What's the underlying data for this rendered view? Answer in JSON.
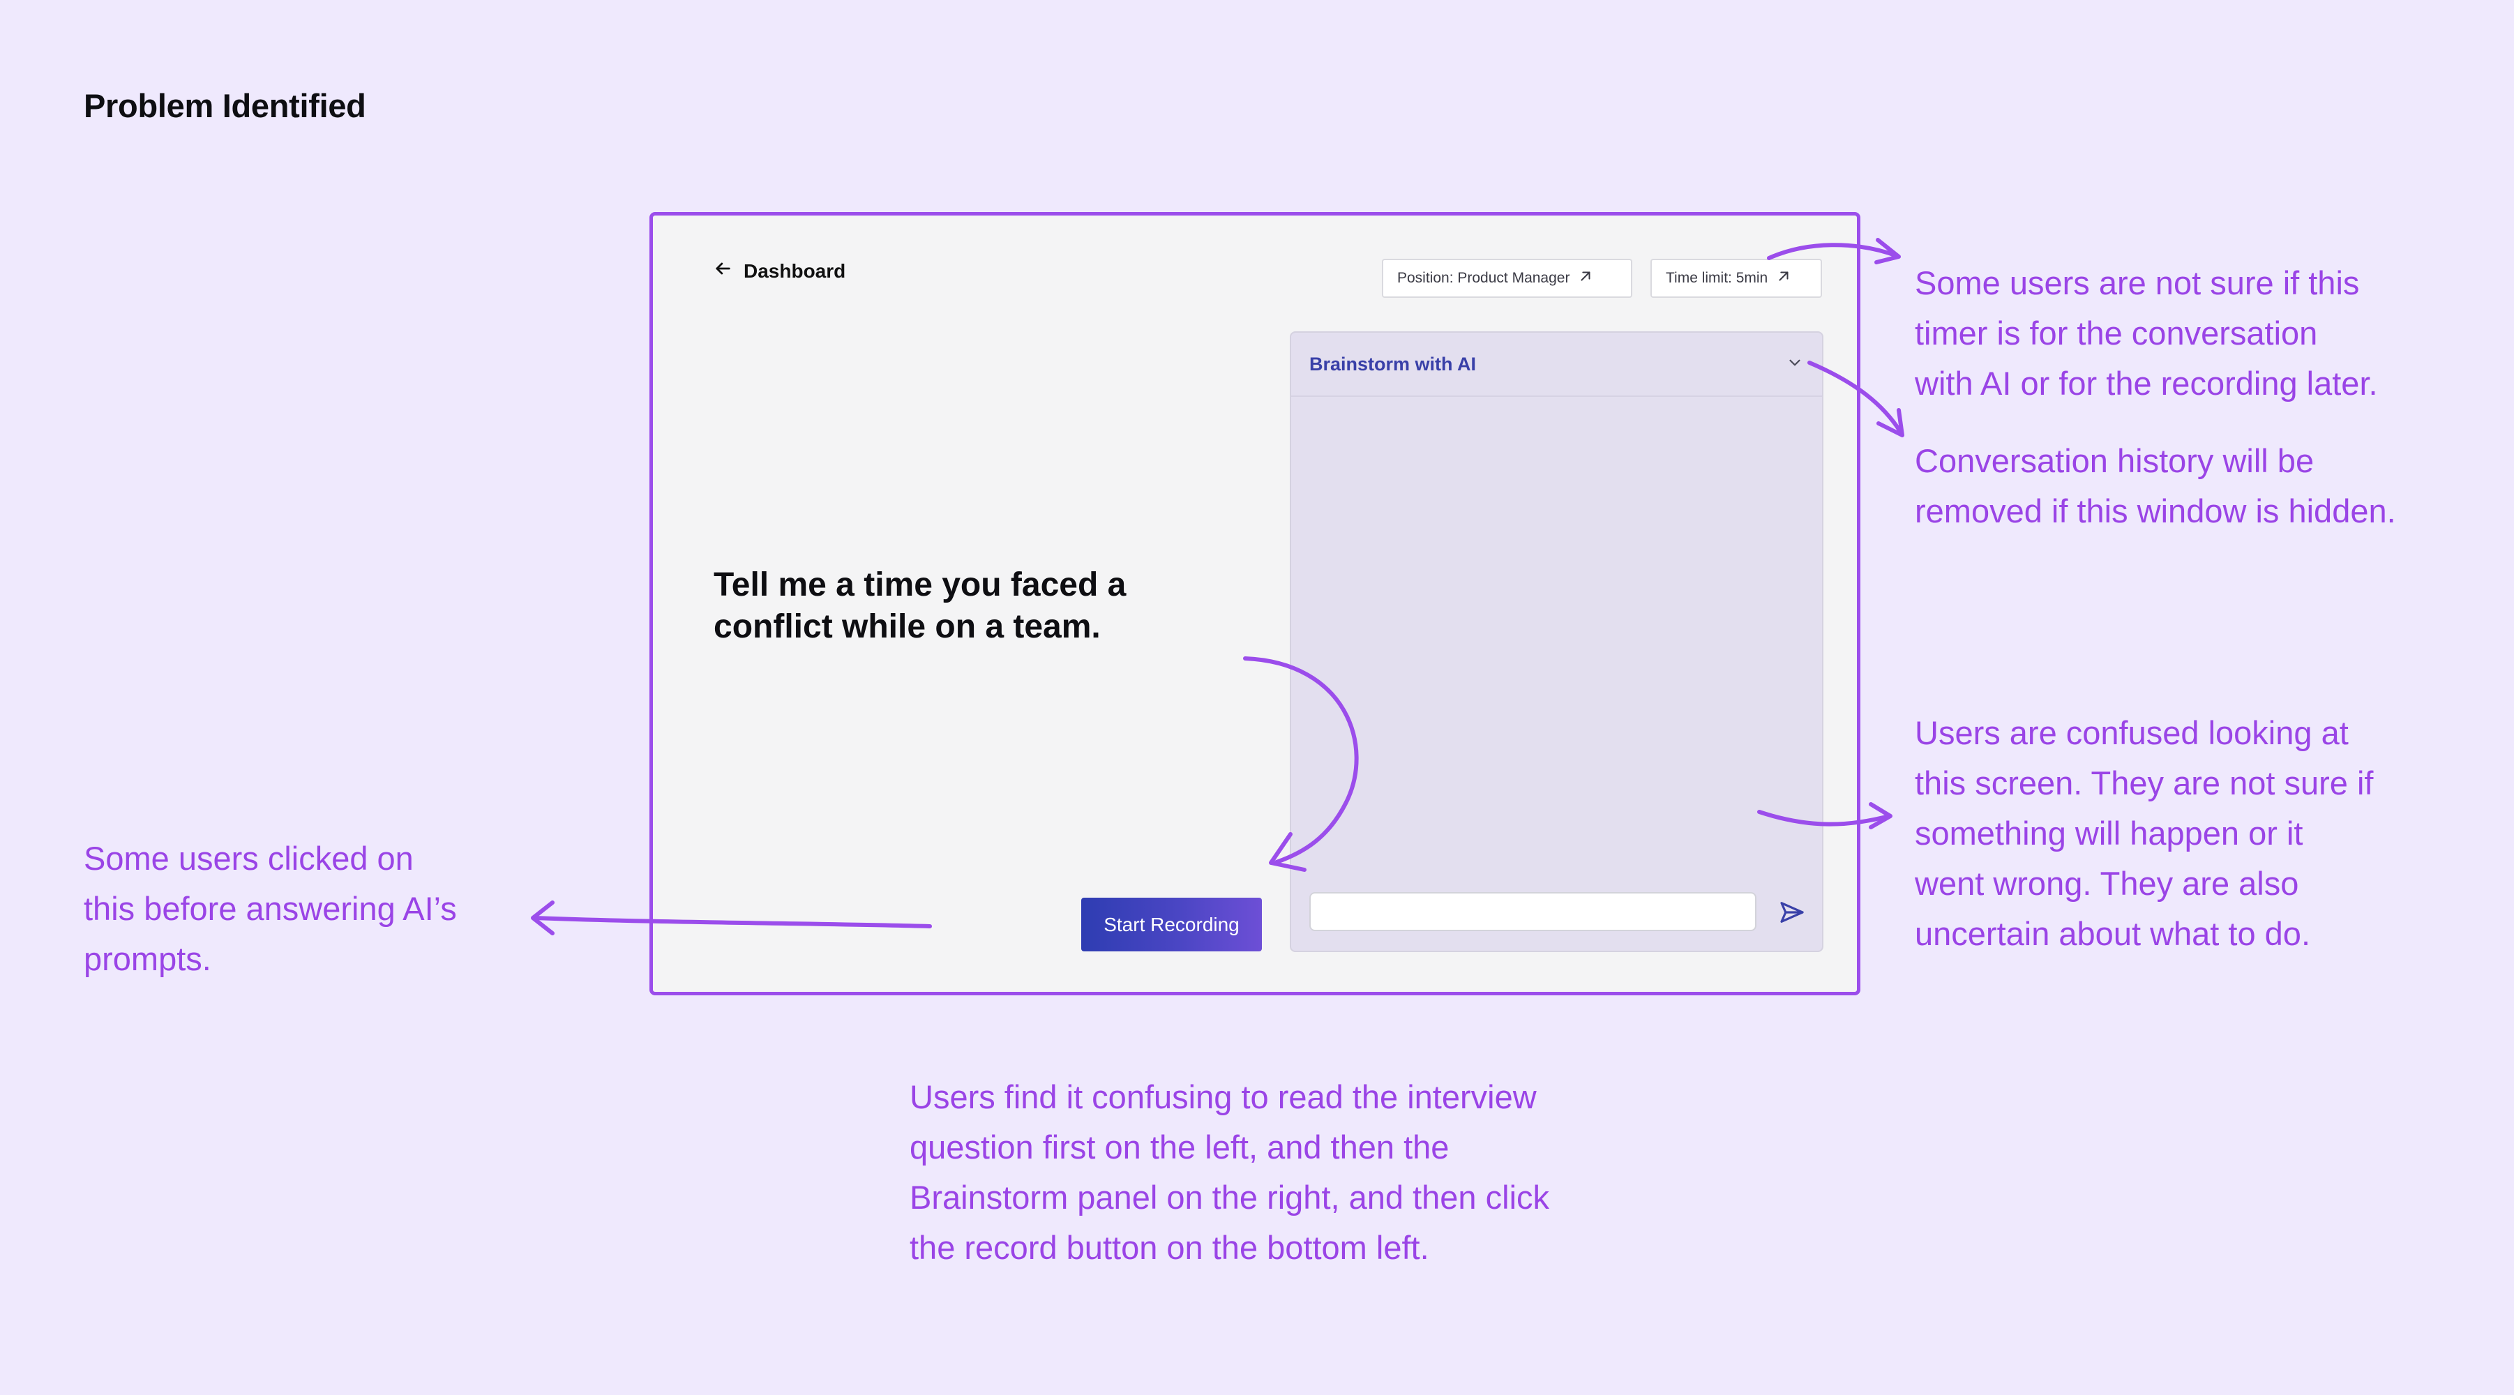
{
  "page": {
    "title": "Problem Identified"
  },
  "mockup": {
    "back_label": "Dashboard",
    "position_chip": "Position: Product Manager",
    "timer_chip": "Time limit: 5min",
    "question": "Tell me a time you faced a conflict while on a team.",
    "record_button": "Start Recording",
    "brainstorm": {
      "title": "Brainstorm with AI",
      "input_value": "",
      "input_placeholder": ""
    }
  },
  "annotations": {
    "timer": [
      "Some users are not sure if this",
      "timer is for the conversation",
      "with AI or for the recording later."
    ],
    "history": [
      "Conversation history will be",
      "removed if this window is hidden."
    ],
    "confused": [
      "Users are confused looking at",
      "this screen. They are not sure if",
      "something will happen or it",
      "went wrong. They are also",
      "uncertain about what to do."
    ],
    "record": [
      "Some users clicked on",
      "this before answering AI’s",
      "prompts."
    ],
    "flow": [
      "Users find it confusing to read the interview",
      "question first on the left, and then the",
      "Brainstorm panel on the right, and then click",
      "the record button on the bottom left."
    ]
  },
  "colors": {
    "background": "#EFE9FD",
    "accent": "#9B4DEB",
    "annotation_text": "#9A44E6",
    "button_gradient_start": "#2E3DB2",
    "button_gradient_end": "#6D4FD6",
    "panel_title": "#3940A8"
  },
  "icons": {
    "back": "arrow-left-icon",
    "external": "arrow-up-right-icon",
    "collapse": "chevron-down-icon",
    "send": "send-icon"
  }
}
